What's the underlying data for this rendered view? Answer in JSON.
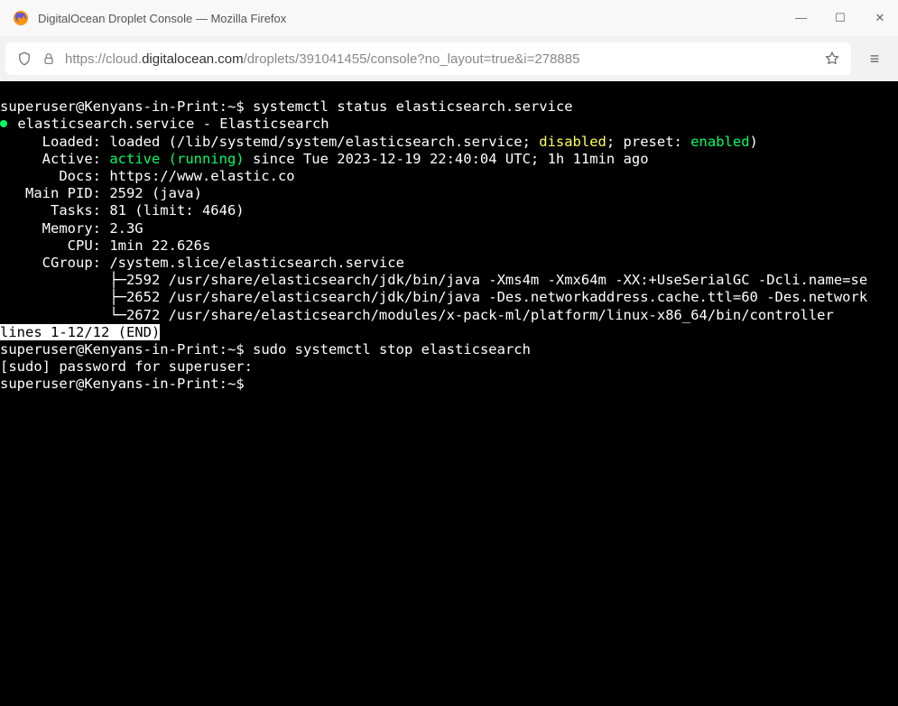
{
  "window": {
    "title": "DigitalOcean Droplet Console — Mozilla Firefox"
  },
  "url": {
    "prefix": "https://cloud.",
    "host": "digitalocean.com",
    "suffix": "/droplets/391041455/console?no_layout=true&i=278885"
  },
  "terminal": {
    "prompt_user": "superuser@Kenyans-in-Print",
    "prompt_path": "~",
    "cmd1": "systemctl status elasticsearch.service",
    "unit_line": "elasticsearch.service - Elasticsearch",
    "loaded_pre": "     Loaded: loaded (/lib/systemd/system/elasticsearch.service; ",
    "loaded_disabled": "disabled",
    "loaded_mid": "; preset: ",
    "loaded_enabled": "enabled",
    "loaded_end": ")",
    "active_pre": "     Active: ",
    "active_status": "active (running)",
    "active_post": " since Tue 2023-12-19 22:40:04 UTC; 1h 11min ago",
    "docs": "       Docs: https://www.elastic.co",
    "mainpid": "   Main PID: 2592 (java)",
    "tasks": "      Tasks: 81 (limit: 4646)",
    "memory": "     Memory: 2.3G",
    "cpu": "        CPU: 1min 22.626s",
    "cgroup": "     CGroup: /system.slice/elasticsearch.service",
    "tree1": "             ├─2592 /usr/share/elasticsearch/jdk/bin/java -Xms4m -Xmx64m -XX:+UseSerialGC -Dcli.name=se",
    "tree2": "             ├─2652 /usr/share/elasticsearch/jdk/bin/java -Des.networkaddress.cache.ttl=60 -Des.network",
    "tree3": "             └─2672 /usr/share/elasticsearch/modules/x-pack-ml/platform/linux-x86_64/bin/controller",
    "pager": "lines 1-12/12 (END)",
    "cmd2": "sudo systemctl stop elasticsearch",
    "sudopw": "[sudo] password for superuser:"
  }
}
